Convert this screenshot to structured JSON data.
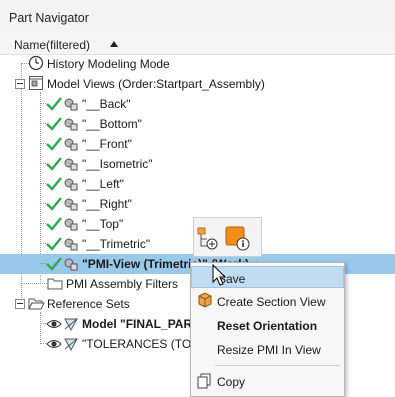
{
  "window": {
    "title": "Part Navigator"
  },
  "column": {
    "header": "Name(filtered)",
    "sort": "ascending"
  },
  "tree": {
    "history_mode": "History Modeling Mode",
    "model_views": "Model Views (Order:Startpart_Assembly)",
    "views": [
      "\"__Back\"",
      "\"__Bottom\"",
      "\"__Front\"",
      "\"__Isometric\"",
      "\"__Left\"",
      "\"__Right\"",
      "\"__Top\"",
      "\"__Trimetric\""
    ],
    "work_view": "\"PMI-View (Trimetric)\" (Work)",
    "pmi_filters": "PMI Assembly Filters",
    "reference_sets": "Reference Sets",
    "model_ref": "Model \"FINAL_PART\"",
    "tolerances_ref": "\"TOLERANCES (TOLERANCES)\""
  },
  "context_menu": {
    "items": [
      "Save",
      "Create Section View",
      "Reset Orientation",
      "Resize PMI In View",
      "Copy"
    ],
    "highlighted": "Save"
  },
  "colors": {
    "check": "#2fa84f",
    "selection": "#99c9ea",
    "menu_highlight": "#c1dcf1",
    "orange": "#f28c1a"
  }
}
